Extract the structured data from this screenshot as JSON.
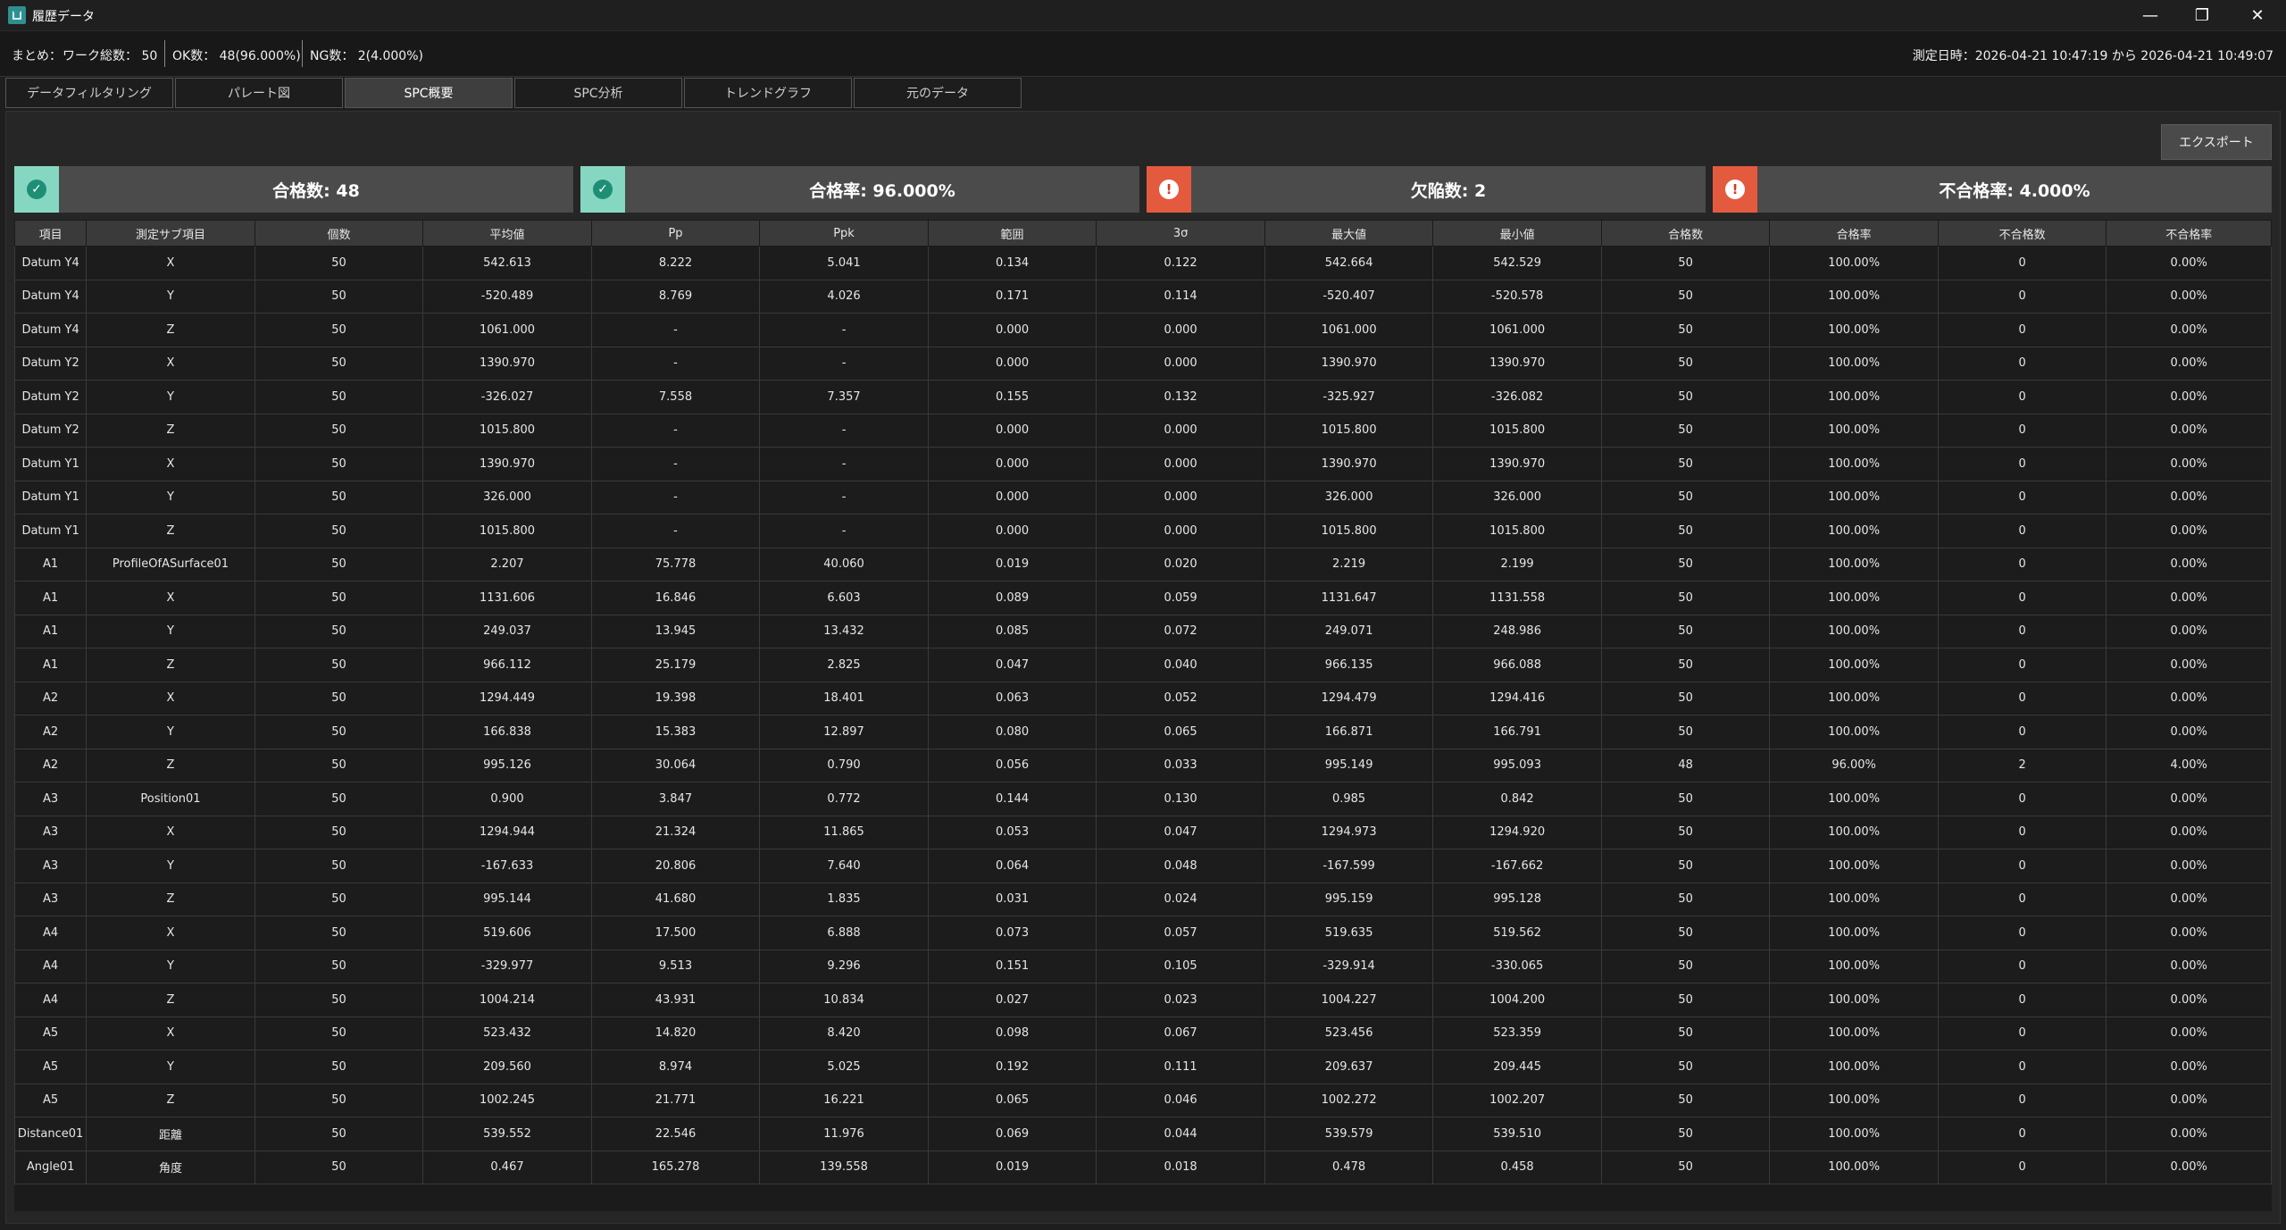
{
  "window": {
    "title": "履歴データ",
    "minimize": "—",
    "restore": "❐",
    "close": "✕"
  },
  "summary": {
    "label": "まとめ：",
    "total": "ワーク総数： 50",
    "ok": "OK数： 48(96.000%)",
    "ng": "NG数： 2(4.000%)",
    "date_range": "測定日時：2026-04-21 10:47:19 から 2026-04-21 10:49:07"
  },
  "tabs": [
    "データフィルタリング",
    "パレート図",
    "SPC概要",
    "SPC分析",
    "トレンドグラフ",
    "元のデータ"
  ],
  "active_tab": 2,
  "export_label": "エクスポート",
  "cards": [
    {
      "text": "合格数: 48",
      "status": "ok",
      "icon": "check-circle-icon",
      "glyph": "✓"
    },
    {
      "text": "合格率: 96.000%",
      "status": "ok",
      "icon": "check-circle-icon",
      "glyph": "✓"
    },
    {
      "text": "欠陥数: 2",
      "status": "ng",
      "icon": "alert-circle-icon",
      "glyph": "!"
    },
    {
      "text": "不合格率: 4.000%",
      "status": "ng",
      "icon": "alert-circle-icon",
      "glyph": "!"
    }
  ],
  "colors": {
    "ok_accent": "#86d7c1",
    "ng_accent": "#e45a3f",
    "card_bg": "#4b4b4b"
  },
  "table": {
    "headers": [
      "項目",
      "測定サブ項目",
      "個数",
      "平均値",
      "Pp",
      "Ppk",
      "範囲",
      "3σ",
      "最大値",
      "最小値",
      "合格数",
      "合格率",
      "不合格数",
      "不合格率"
    ],
    "rows": [
      [
        "Datum Y4",
        "X",
        "50",
        "542.613",
        "8.222",
        "5.041",
        "0.134",
        "0.122",
        "542.664",
        "542.529",
        "50",
        "100.00%",
        "0",
        "0.00%"
      ],
      [
        "Datum Y4",
        "Y",
        "50",
        "-520.489",
        "8.769",
        "4.026",
        "0.171",
        "0.114",
        "-520.407",
        "-520.578",
        "50",
        "100.00%",
        "0",
        "0.00%"
      ],
      [
        "Datum Y4",
        "Z",
        "50",
        "1061.000",
        "-",
        "-",
        "0.000",
        "0.000",
        "1061.000",
        "1061.000",
        "50",
        "100.00%",
        "0",
        "0.00%"
      ],
      [
        "Datum Y2",
        "X",
        "50",
        "1390.970",
        "-",
        "-",
        "0.000",
        "0.000",
        "1390.970",
        "1390.970",
        "50",
        "100.00%",
        "0",
        "0.00%"
      ],
      [
        "Datum Y2",
        "Y",
        "50",
        "-326.027",
        "7.558",
        "7.357",
        "0.155",
        "0.132",
        "-325.927",
        "-326.082",
        "50",
        "100.00%",
        "0",
        "0.00%"
      ],
      [
        "Datum Y2",
        "Z",
        "50",
        "1015.800",
        "-",
        "-",
        "0.000",
        "0.000",
        "1015.800",
        "1015.800",
        "50",
        "100.00%",
        "0",
        "0.00%"
      ],
      [
        "Datum Y1",
        "X",
        "50",
        "1390.970",
        "-",
        "-",
        "0.000",
        "0.000",
        "1390.970",
        "1390.970",
        "50",
        "100.00%",
        "0",
        "0.00%"
      ],
      [
        "Datum Y1",
        "Y",
        "50",
        "326.000",
        "-",
        "-",
        "0.000",
        "0.000",
        "326.000",
        "326.000",
        "50",
        "100.00%",
        "0",
        "0.00%"
      ],
      [
        "Datum Y1",
        "Z",
        "50",
        "1015.800",
        "-",
        "-",
        "0.000",
        "0.000",
        "1015.800",
        "1015.800",
        "50",
        "100.00%",
        "0",
        "0.00%"
      ],
      [
        "A1",
        "ProfileOfASurface01",
        "50",
        "2.207",
        "75.778",
        "40.060",
        "0.019",
        "0.020",
        "2.219",
        "2.199",
        "50",
        "100.00%",
        "0",
        "0.00%"
      ],
      [
        "A1",
        "X",
        "50",
        "1131.606",
        "16.846",
        "6.603",
        "0.089",
        "0.059",
        "1131.647",
        "1131.558",
        "50",
        "100.00%",
        "0",
        "0.00%"
      ],
      [
        "A1",
        "Y",
        "50",
        "249.037",
        "13.945",
        "13.432",
        "0.085",
        "0.072",
        "249.071",
        "248.986",
        "50",
        "100.00%",
        "0",
        "0.00%"
      ],
      [
        "A1",
        "Z",
        "50",
        "966.112",
        "25.179",
        "2.825",
        "0.047",
        "0.040",
        "966.135",
        "966.088",
        "50",
        "100.00%",
        "0",
        "0.00%"
      ],
      [
        "A2",
        "X",
        "50",
        "1294.449",
        "19.398",
        "18.401",
        "0.063",
        "0.052",
        "1294.479",
        "1294.416",
        "50",
        "100.00%",
        "0",
        "0.00%"
      ],
      [
        "A2",
        "Y",
        "50",
        "166.838",
        "15.383",
        "12.897",
        "0.080",
        "0.065",
        "166.871",
        "166.791",
        "50",
        "100.00%",
        "0",
        "0.00%"
      ],
      [
        "A2",
        "Z",
        "50",
        "995.126",
        "30.064",
        "0.790",
        "0.056",
        "0.033",
        "995.149",
        "995.093",
        "48",
        "96.00%",
        "2",
        "4.00%"
      ],
      [
        "A3",
        "Position01",
        "50",
        "0.900",
        "3.847",
        "0.772",
        "0.144",
        "0.130",
        "0.985",
        "0.842",
        "50",
        "100.00%",
        "0",
        "0.00%"
      ],
      [
        "A3",
        "X",
        "50",
        "1294.944",
        "21.324",
        "11.865",
        "0.053",
        "0.047",
        "1294.973",
        "1294.920",
        "50",
        "100.00%",
        "0",
        "0.00%"
      ],
      [
        "A3",
        "Y",
        "50",
        "-167.633",
        "20.806",
        "7.640",
        "0.064",
        "0.048",
        "-167.599",
        "-167.662",
        "50",
        "100.00%",
        "0",
        "0.00%"
      ],
      [
        "A3",
        "Z",
        "50",
        "995.144",
        "41.680",
        "1.835",
        "0.031",
        "0.024",
        "995.159",
        "995.128",
        "50",
        "100.00%",
        "0",
        "0.00%"
      ],
      [
        "A4",
        "X",
        "50",
        "519.606",
        "17.500",
        "6.888",
        "0.073",
        "0.057",
        "519.635",
        "519.562",
        "50",
        "100.00%",
        "0",
        "0.00%"
      ],
      [
        "A4",
        "Y",
        "50",
        "-329.977",
        "9.513",
        "9.296",
        "0.151",
        "0.105",
        "-329.914",
        "-330.065",
        "50",
        "100.00%",
        "0",
        "0.00%"
      ],
      [
        "A4",
        "Z",
        "50",
        "1004.214",
        "43.931",
        "10.834",
        "0.027",
        "0.023",
        "1004.227",
        "1004.200",
        "50",
        "100.00%",
        "0",
        "0.00%"
      ],
      [
        "A5",
        "X",
        "50",
        "523.432",
        "14.820",
        "8.420",
        "0.098",
        "0.067",
        "523.456",
        "523.359",
        "50",
        "100.00%",
        "0",
        "0.00%"
      ],
      [
        "A5",
        "Y",
        "50",
        "209.560",
        "8.974",
        "5.025",
        "0.192",
        "0.111",
        "209.637",
        "209.445",
        "50",
        "100.00%",
        "0",
        "0.00%"
      ],
      [
        "A5",
        "Z",
        "50",
        "1002.245",
        "21.771",
        "16.221",
        "0.065",
        "0.046",
        "1002.272",
        "1002.207",
        "50",
        "100.00%",
        "0",
        "0.00%"
      ],
      [
        "Distance01",
        "距離",
        "50",
        "539.552",
        "22.546",
        "11.976",
        "0.069",
        "0.044",
        "539.579",
        "539.510",
        "50",
        "100.00%",
        "0",
        "0.00%"
      ],
      [
        "Angle01",
        "角度",
        "50",
        "0.467",
        "165.278",
        "139.558",
        "0.019",
        "0.018",
        "0.478",
        "0.458",
        "50",
        "100.00%",
        "0",
        "0.00%"
      ]
    ]
  }
}
